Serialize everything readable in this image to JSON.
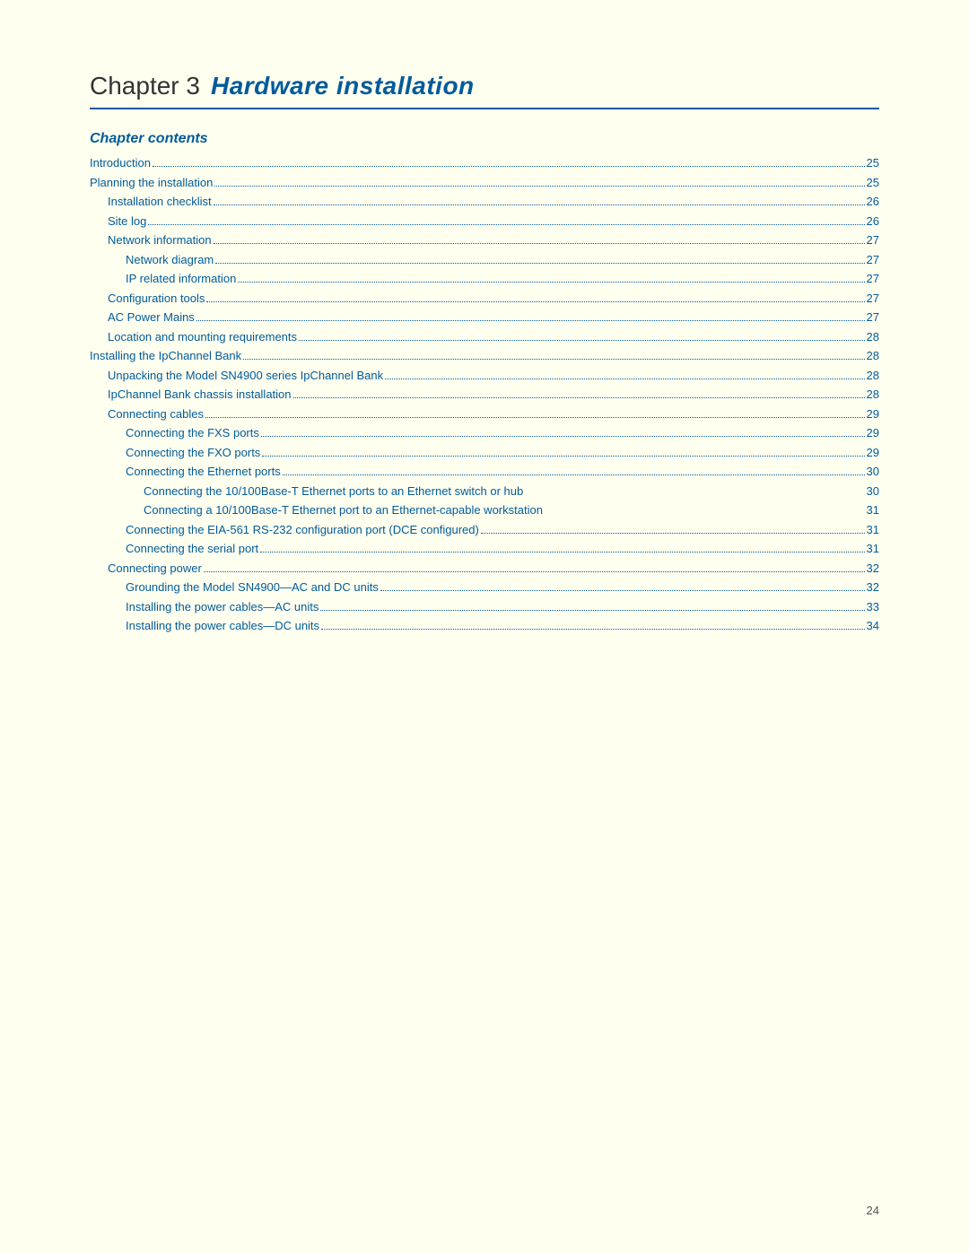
{
  "page": {
    "background": "#fffff0",
    "page_number": "24"
  },
  "header": {
    "chapter_label": "Chapter 3",
    "chapter_title": "Hardware installation"
  },
  "section": {
    "chapter_contents_label": "Chapter contents"
  },
  "toc": [
    {
      "level": 0,
      "label": "Introduction",
      "page": "25"
    },
    {
      "level": 0,
      "label": "Planning the installation",
      "page": "25"
    },
    {
      "level": 1,
      "label": "Installation checklist",
      "page": "26"
    },
    {
      "level": 1,
      "label": "Site log",
      "page": "26"
    },
    {
      "level": 1,
      "label": "Network information",
      "page": "27"
    },
    {
      "level": 2,
      "label": "Network diagram",
      "page": "27"
    },
    {
      "level": 2,
      "label": "IP related information",
      "page": "27"
    },
    {
      "level": 1,
      "label": "Configuration tools",
      "page": "27"
    },
    {
      "level": 1,
      "label": "AC Power Mains",
      "page": "27"
    },
    {
      "level": 1,
      "label": "Location and mounting requirements",
      "page": "28"
    },
    {
      "level": 0,
      "label": "Installing the IpChannel Bank",
      "page": "28"
    },
    {
      "level": 1,
      "label": "Unpacking the Model SN4900 series IpChannel Bank",
      "page": "28"
    },
    {
      "level": 1,
      "label": "IpChannel Bank chassis installation",
      "page": "28"
    },
    {
      "level": 1,
      "label": "Connecting cables",
      "page": "29"
    },
    {
      "level": 2,
      "label": "Connecting the FXS ports",
      "page": "29"
    },
    {
      "level": 2,
      "label": "Connecting the FXO ports",
      "page": "29"
    },
    {
      "level": 2,
      "label": "Connecting the Ethernet ports",
      "page": "30"
    },
    {
      "level": 3,
      "label": "Connecting the 10/100Base-T Ethernet ports to an Ethernet switch or hub",
      "page": "30",
      "no_dots": true
    },
    {
      "level": 3,
      "label": "Connecting a 10/100Base-T Ethernet port to an Ethernet-capable workstation",
      "page": "31",
      "no_dots": true
    },
    {
      "level": 2,
      "label": "Connecting the EIA-561 RS-232 configuration port (DCE configured)",
      "page": "31"
    },
    {
      "level": 2,
      "label": "Connecting the serial port",
      "page": "31"
    },
    {
      "level": 1,
      "label": "Connecting power",
      "page": "32"
    },
    {
      "level": 2,
      "label": "Grounding the Model SN4900—AC and DC units",
      "page": "32"
    },
    {
      "level": 2,
      "label": "Installing the power cables—AC units",
      "page": "33"
    },
    {
      "level": 2,
      "label": "Installing the power cables—DC units",
      "page": "34"
    }
  ]
}
